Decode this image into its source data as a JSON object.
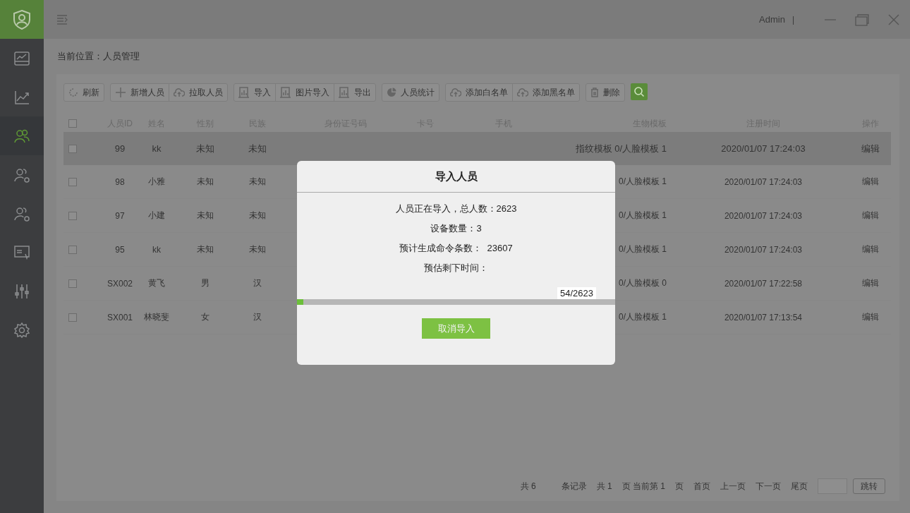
{
  "sidebar": {
    "items": [
      {
        "kind": "monitor",
        "selected": false
      },
      {
        "kind": "chart",
        "selected": false
      },
      {
        "kind": "people",
        "selected": true
      },
      {
        "kind": "person",
        "selected": false
      },
      {
        "kind": "person",
        "selected": false
      },
      {
        "kind": "card",
        "selected": false
      },
      {
        "kind": "sliders",
        "selected": false
      },
      {
        "kind": "gear",
        "selected": false
      }
    ]
  },
  "topbar": {
    "user": "Admin",
    "separator": "|"
  },
  "breadcrumb": "当前位置：人员管理",
  "toolbar": [
    [
      {
        "kind": "refresh",
        "label": "刷新"
      }
    ],
    [
      {
        "kind": "add",
        "label": "新增人员"
      },
      {
        "kind": "upload",
        "label": "拉取人员"
      }
    ],
    [
      {
        "kind": "report",
        "label": "导入"
      },
      {
        "kind": "report",
        "label": "图片导入"
      },
      {
        "kind": "report",
        "label": "导出"
      }
    ],
    [
      {
        "kind": "stats",
        "label": "人员统计"
      }
    ],
    [
      {
        "kind": "upload",
        "label": "添加白名单"
      },
      {
        "kind": "upload",
        "label": "添加黑名单"
      }
    ],
    [
      {
        "kind": "delete",
        "label": "删除"
      }
    ],
    [
      {
        "kind": "search"
      }
    ]
  ],
  "table": {
    "header_checked": false,
    "columns": [
      "人员ID",
      "姓名",
      "性别",
      "民族",
      "身份证号码",
      "卡号",
      "手机",
      "生物模板",
      "注册时间",
      "操作"
    ],
    "rows": [
      {
        "checked": false,
        "selected": true,
        "cells": [
          "99",
          "kk",
          "未知",
          "未知",
          "",
          "",
          "",
          "指纹模板 0/人脸模板 1",
          "2020/01/07 17:24:03",
          "编辑"
        ]
      },
      {
        "checked": false,
        "selected": false,
        "cells": [
          "98",
          "小雅",
          "未知",
          "未知",
          "",
          "",
          "",
          "0/人脸模板 1",
          "2020/01/07 17:24:03",
          "编辑"
        ]
      },
      {
        "checked": false,
        "selected": false,
        "cells": [
          "97",
          "小建",
          "未知",
          "未知",
          "",
          "",
          "",
          "0/人脸模板 1",
          "2020/01/07 17:24:03",
          "编辑"
        ]
      },
      {
        "checked": false,
        "selected": false,
        "cells": [
          "95",
          "kk",
          "未知",
          "未知",
          "",
          "",
          "",
          "0/人脸模板 1",
          "2020/01/07 17:24:03",
          "编辑"
        ]
      },
      {
        "checked": false,
        "selected": false,
        "cells": [
          "SX002",
          "黄飞",
          "男",
          "汉",
          "",
          "",
          "",
          "0/人脸模板 0",
          "2020/01/07 17:22:58",
          "编辑"
        ]
      },
      {
        "checked": false,
        "selected": false,
        "cells": [
          "SX001",
          "林晓斐",
          "女",
          "汉",
          "",
          "",
          "",
          "0/人脸模板 1",
          "2020/01/07 17:13:54",
          "编辑"
        ]
      }
    ]
  },
  "pagination": {
    "info": [
      "共 6",
      "条记录",
      "共 1",
      "页 当前第 1",
      "页"
    ],
    "links": [
      "首页",
      "上一页",
      "下一页",
      "尾页"
    ],
    "jump": "跳转"
  },
  "dialog": {
    "title": "导入人员",
    "lines": [
      "人员正在导入，总人数：2623",
      "设备数量：3",
      "预计生成命令条数：  23607",
      "预估剩下时间："
    ],
    "progress": {
      "reading": "54/2623",
      "level": 0.0206
    },
    "button": "取消导入"
  }
}
